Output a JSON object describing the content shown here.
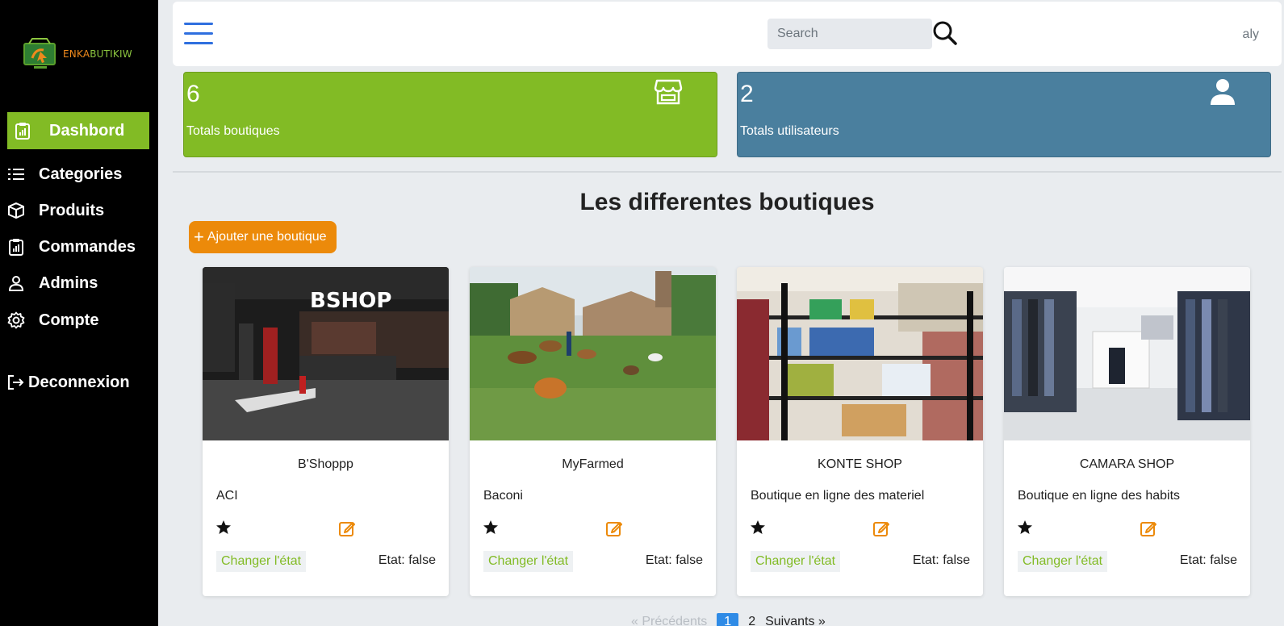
{
  "brand": {
    "part1": "ENKA",
    "part2": "BUTIKIW"
  },
  "sidebar": {
    "items": [
      {
        "label": "Dashbord",
        "icon": "clipboard-chart-icon"
      },
      {
        "label": "Categories",
        "icon": "list-icon"
      },
      {
        "label": "Produits",
        "icon": "box-icon"
      },
      {
        "label": "Commandes",
        "icon": "clipboard-chart-icon"
      },
      {
        "label": "Admins",
        "icon": "user-icon"
      },
      {
        "label": "Compte",
        "icon": "gear-icon"
      }
    ],
    "logout": {
      "label": "Deconnexion",
      "icon": "logout-icon"
    }
  },
  "topbar": {
    "search_placeholder": "Search",
    "search_value": "",
    "user": "aly"
  },
  "stats": [
    {
      "value": "6",
      "label": "Totals boutiques",
      "icon": "store-icon",
      "color": "#82bb25"
    },
    {
      "value": "2",
      "label": "Totals utilisateurs",
      "icon": "user-icon",
      "color": "#4a7f9e"
    }
  ],
  "main": {
    "title": "Les differentes boutiques",
    "add_label": "Ajouter une boutique"
  },
  "shops": [
    {
      "name": "B'Shoppp",
      "description": "ACI",
      "toggle_label": "Changer l'état",
      "state": "Etat: false"
    },
    {
      "name": "MyFarmed",
      "description": "Baconi",
      "toggle_label": "Changer l'état",
      "state": "Etat: false"
    },
    {
      "name": "KONTE SHOP",
      "description": "Boutique en ligne des materiel",
      "toggle_label": "Changer l'état",
      "state": "Etat: false"
    },
    {
      "name": "CAMARA SHOP",
      "description": "Boutique en ligne des habits",
      "toggle_label": "Changer l'état",
      "state": "Etat: false"
    }
  ],
  "pagination": {
    "prev": "«   Précédents",
    "pages": [
      "1",
      "2"
    ],
    "current": "1",
    "next": "Suivants   »"
  },
  "colors": {
    "accent_green": "#82bb25",
    "accent_blue": "#4a7f9e",
    "accent_orange": "#ec8a0a",
    "pager_active": "#2f8be6"
  }
}
